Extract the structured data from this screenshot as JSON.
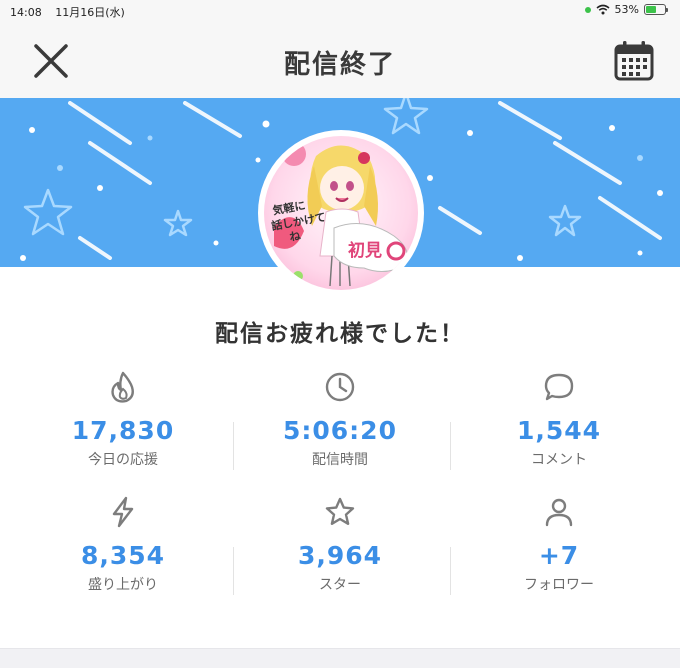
{
  "statusbar": {
    "time": "14:08",
    "date": "11月16日(水)",
    "battery": "53%",
    "battery_level": 0.53
  },
  "header": {
    "title": "配信終了",
    "close_icon": "close-icon",
    "calendar_icon": "calendar-icon"
  },
  "colors": {
    "banner": "#55a9f2",
    "accent": "#3b8ee6",
    "header_bg": "#f7f7f7"
  },
  "avatar": {
    "text_hatsumi": "初見",
    "text_kigaru_1": "気軽に",
    "text_kigaru_2": "話しかけて",
    "text_kigaru_3": "ね"
  },
  "message": "配信お疲れ様でした！",
  "stats": [
    {
      "icon": "flame-icon",
      "value": "17,830",
      "label": "今日の応援"
    },
    {
      "icon": "clock-icon",
      "value": "5:06:20",
      "label": "配信時間"
    },
    {
      "icon": "comment-icon",
      "value": "1,544",
      "label": "コメント"
    },
    {
      "icon": "lightning-icon",
      "value": "8,354",
      "label": "盛り上がり"
    },
    {
      "icon": "star-icon",
      "value": "3,964",
      "label": "スター"
    },
    {
      "icon": "user-icon",
      "value": "+7",
      "label": "フォロワー"
    }
  ]
}
